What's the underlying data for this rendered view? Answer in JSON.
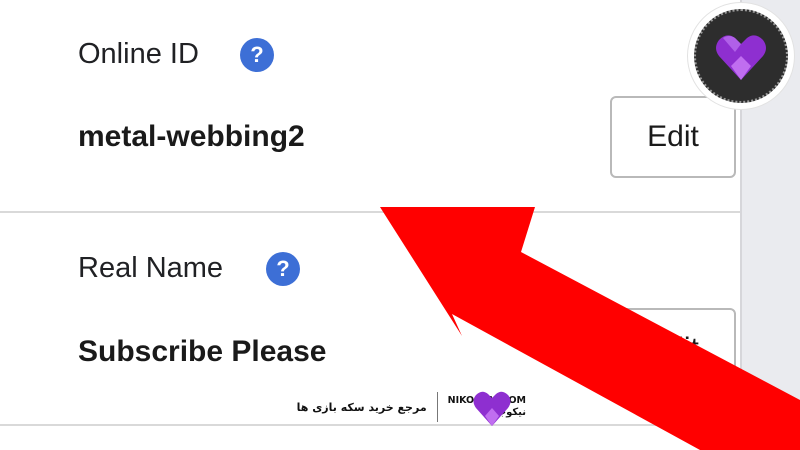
{
  "profile": {
    "online_id": {
      "label": "Online ID",
      "help_glyph": "?",
      "value": "metal-webbing2",
      "edit_label": "Edit"
    },
    "real_name": {
      "label": "Real Name",
      "help_glyph": "?",
      "value": "Subscribe Please",
      "edit_label": "Edit"
    }
  },
  "overlay": {
    "arrow_color": "#ff0000",
    "arrow_icon": "red-arrow-pointer"
  },
  "watermark": {
    "tagline": "مرجع خرید سکه بازی ها",
    "url": "NIKOGEM.COM",
    "name": "نیکوجم",
    "logo_icon": "nikogem-heart-logo",
    "brand_color": "#8e2fd0"
  },
  "colors": {
    "help_icon": "#3d6fd6",
    "logo_background": "#2d2d2d"
  }
}
